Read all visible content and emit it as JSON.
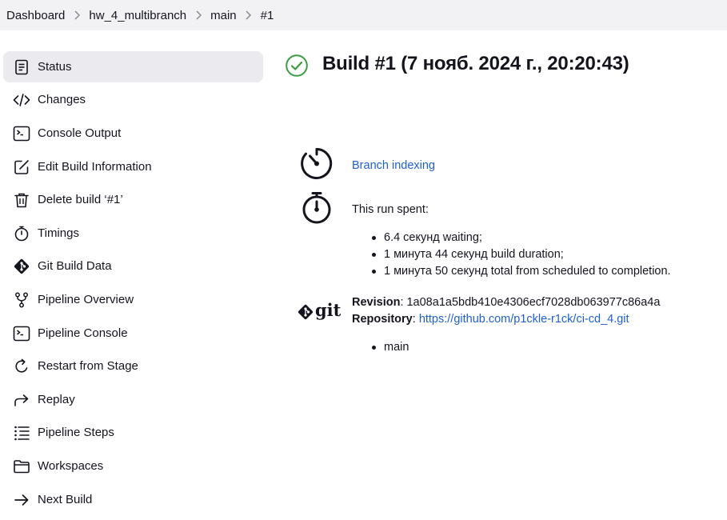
{
  "breadcrumb": {
    "items": [
      "Dashboard",
      "hw_4_multibranch",
      "main",
      "#1"
    ]
  },
  "sidebar": {
    "items": [
      {
        "label": "Status",
        "icon": "document-icon",
        "active": true
      },
      {
        "label": "Changes",
        "icon": "code-icon"
      },
      {
        "label": "Console Output",
        "icon": "terminal-icon"
      },
      {
        "label": "Edit Build Information",
        "icon": "edit-icon"
      },
      {
        "label": "Delete build ‘#1’",
        "icon": "trash-icon"
      },
      {
        "label": "Timings",
        "icon": "stopwatch-icon"
      },
      {
        "label": "Git Build Data",
        "icon": "git-icon"
      },
      {
        "label": "Pipeline Overview",
        "icon": "branch-fork-icon"
      },
      {
        "label": "Pipeline Console",
        "icon": "terminal-icon"
      },
      {
        "label": "Restart from Stage",
        "icon": "restart-icon"
      },
      {
        "label": "Replay",
        "icon": "replay-arrow-icon"
      },
      {
        "label": "Pipeline Steps",
        "icon": "steps-list-icon"
      },
      {
        "label": "Workspaces",
        "icon": "folder-icon"
      },
      {
        "label": "Next Build",
        "icon": "arrow-right-icon"
      }
    ]
  },
  "main": {
    "title": "Build #1 (7 нояб. 2024 г., 20:20:43)",
    "status": "success",
    "trigger": {
      "label": "Branch indexing",
      "icon": "gauge-icon"
    },
    "timing": {
      "label": "This run spent:",
      "icon": "stopwatch-icon",
      "items": [
        "6.4 секунд waiting;",
        "1 минута 44 секунд build duration;",
        "1 минута 50 секунд total from scheduled to completion."
      ]
    },
    "git": {
      "logo_text": "git",
      "revision_label": "Revision",
      "revision_value": ": 1a08a1a5bdb410e4306ecf7028db063977c86a4a",
      "repository_label": "Repository",
      "repository_sep": ": ",
      "repository_url": "https://github.com/p1ckle-r1ck/ci-cd_4.git",
      "branches": [
        "main"
      ]
    }
  },
  "colors": {
    "success": "#3a9d3f",
    "link": "#1f5fd6",
    "breadcrumb_bg": "#f2f2f5",
    "active_item_bg": "#ebebef"
  }
}
